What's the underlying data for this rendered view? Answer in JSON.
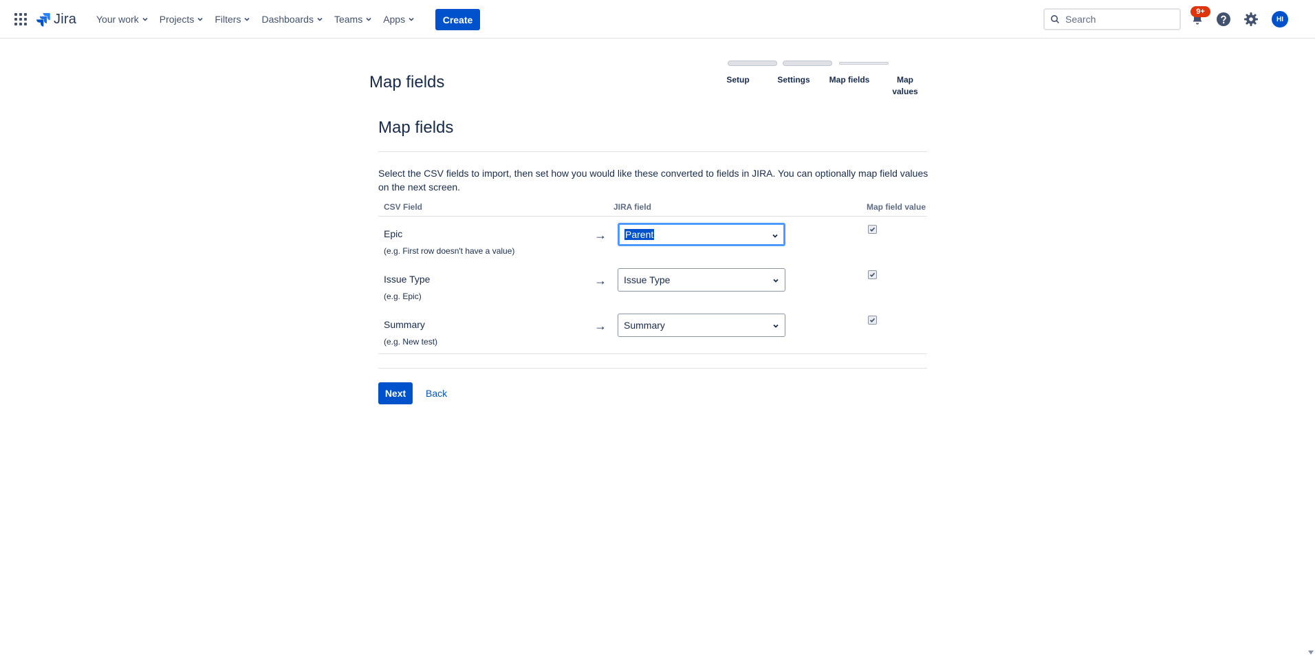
{
  "nav": {
    "logo_text": "Jira",
    "items": [
      {
        "label": "Your work"
      },
      {
        "label": "Projects"
      },
      {
        "label": "Filters"
      },
      {
        "label": "Dashboards"
      },
      {
        "label": "Teams"
      },
      {
        "label": "Apps"
      }
    ],
    "create_label": "Create",
    "search_placeholder": "Search",
    "notifications_badge": "9+",
    "avatar_initials": "HI",
    "icons": [
      "app-switcher-icon",
      "jira-logo-icon",
      "search-icon",
      "notification-bell-icon",
      "help-icon",
      "settings-gear-icon"
    ],
    "brand_color": "#0052cc",
    "badge_color": "#de350b"
  },
  "page": {
    "title": "Map fields"
  },
  "steps": {
    "labels": [
      "Setup",
      "Settings",
      "Map fields",
      "Map values"
    ],
    "current": "Map fields"
  },
  "form": {
    "title": "Map fields",
    "description": "Select the CSV fields to import, then set how you would like these converted to fields in JIRA. You can optionally map field values on the next screen.",
    "columns": {
      "csv_field": "CSV Field",
      "jira_field": "JIRA field",
      "map_value": "Map field value"
    },
    "rows": [
      {
        "csv_field": "Epic",
        "example": "(e.g.  First row doesn't have a value)",
        "arrow": "→",
        "jira_field": "Parent",
        "map_value_checked": true,
        "focused": true
      },
      {
        "csv_field": "Issue Type",
        "example": "(e.g.  Epic)",
        "arrow": "→",
        "jira_field": "Issue Type",
        "map_value_checked": true,
        "focused": false
      },
      {
        "csv_field": "Summary",
        "example": "(e.g.  New test)",
        "arrow": "→",
        "jira_field": "Summary",
        "map_value_checked": true,
        "focused": false
      }
    ],
    "next_label": "Next",
    "back_label": "Back"
  }
}
